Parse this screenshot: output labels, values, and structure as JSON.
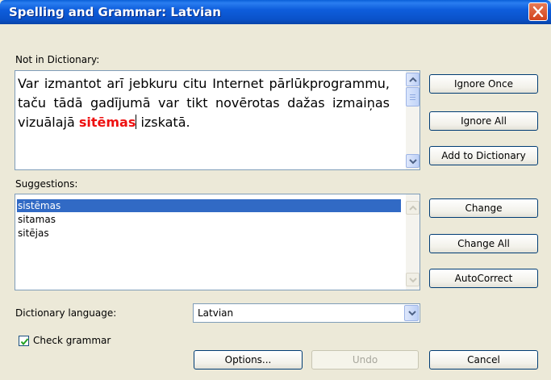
{
  "window": {
    "title": "Spelling and Grammar: Latvian"
  },
  "labels": {
    "not_in_dictionary": "Not in Dictionary:",
    "suggestions": "Suggestions:",
    "dictionary_language": "Dictionary language:",
    "check_grammar": "Check grammar"
  },
  "sentence": {
    "before": "Var izmantot arī jebkuru citu Internet pārlūkprogrammu, taču tādā gadījumā var tikt novērotas dažas izmaiņas vizuālajā",
    "error_word": "sitēmas",
    "after": "izskatā."
  },
  "suggestions": {
    "items": [
      "sistēmas",
      "sitamas",
      "sitējas"
    ],
    "selected_index": 0
  },
  "buttons": {
    "ignore_once": "Ignore Once",
    "ignore_all": "Ignore All",
    "add_to_dictionary": "Add to Dictionary",
    "change": "Change",
    "change_all": "Change All",
    "autocorrect": "AutoCorrect",
    "options": "Options...",
    "undo": "Undo",
    "cancel": "Cancel"
  },
  "dictionary_language": {
    "value": "Latvian"
  },
  "check_grammar": {
    "checked": true
  },
  "colors": {
    "error_word": "#ee1111",
    "selection": "#316ac5",
    "titlebar": "#0a52c9"
  },
  "icons": {
    "close": "close-icon",
    "scroll_up": "scroll-up-arrow-icon",
    "scroll_down": "scroll-down-arrow-icon",
    "dropdown": "chevron-down-icon",
    "check": "checkmark-icon"
  }
}
